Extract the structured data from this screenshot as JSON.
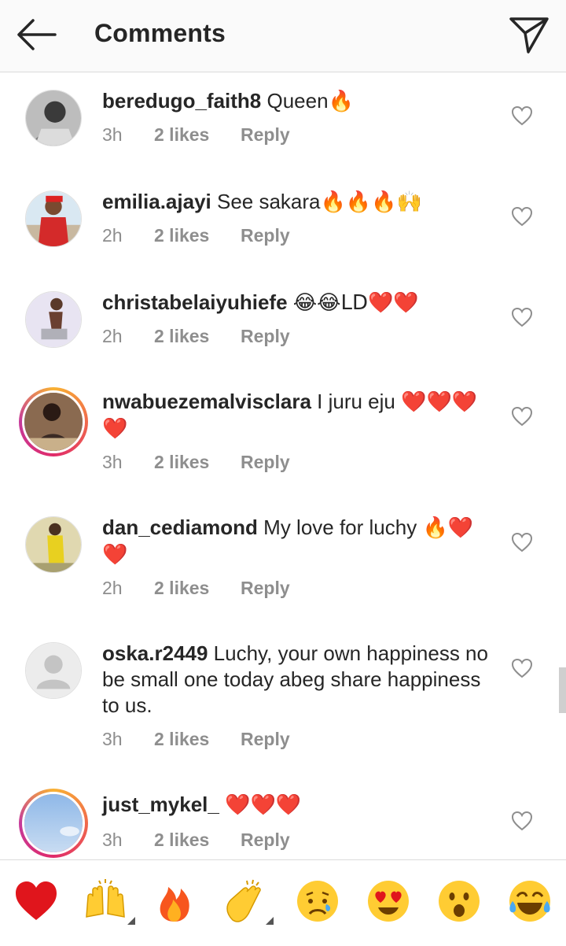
{
  "header": {
    "title": "Comments",
    "back_icon": "arrow-left-icon",
    "send_icon": "paper-plane-icon"
  },
  "comments": [
    {
      "username": "beredugo_faith8",
      "text": " Queen",
      "emoji": "🔥",
      "time": "3h",
      "likes": "2 likes",
      "reply": "Reply"
    },
    {
      "username": "emilia.ajayi",
      "text": " See sakara",
      "emoji": "🔥🔥🔥🙌",
      "time": "2h",
      "likes": "2 likes",
      "reply": "Reply"
    },
    {
      "username": "christabelaiyuhiefe",
      "text": " ",
      "emoji": "😂😂LD❤️❤️",
      "time": "2h",
      "likes": "2 likes",
      "reply": "Reply"
    },
    {
      "username": "nwabuezemalvisclara",
      "text": " I juru eju ",
      "emoji": "❤️❤️❤️❤️",
      "time": "3h",
      "likes": "2 likes",
      "reply": "Reply"
    },
    {
      "username": "dan_cediamond",
      "text": " My love for luchy ",
      "emoji": "🔥❤️❤️",
      "time": "2h",
      "likes": "2 likes",
      "reply": "Reply"
    },
    {
      "username": "oska.r2449",
      "text": " Luchy, your own happiness no be small one today abeg share happiness to us.",
      "emoji": "",
      "time": "3h",
      "likes": "2 likes",
      "reply": "Reply"
    },
    {
      "username": "just_mykel_",
      "text": " ",
      "emoji": "❤️❤️❤️",
      "time": "3h",
      "likes": "2 likes",
      "reply": "Reply"
    }
  ],
  "emoji_bar": [
    {
      "name": "red-heart",
      "glyph": "❤️"
    },
    {
      "name": "raising-hands",
      "glyph": "🙌"
    },
    {
      "name": "fire",
      "glyph": "🔥"
    },
    {
      "name": "clapping-hands",
      "glyph": "👏"
    },
    {
      "name": "crying-face",
      "glyph": "😢"
    },
    {
      "name": "heart-eyes",
      "glyph": "😍"
    },
    {
      "name": "surprised-face",
      "glyph": "😮"
    },
    {
      "name": "tears-of-joy",
      "glyph": "😂"
    }
  ],
  "colors": {
    "text": "#262626",
    "meta": "#8e8e8e",
    "header_bg": "#fafafa",
    "heart_red": "#e0151c",
    "fire": "#f77b1e",
    "emoji_yellow": "#ffcc33"
  }
}
